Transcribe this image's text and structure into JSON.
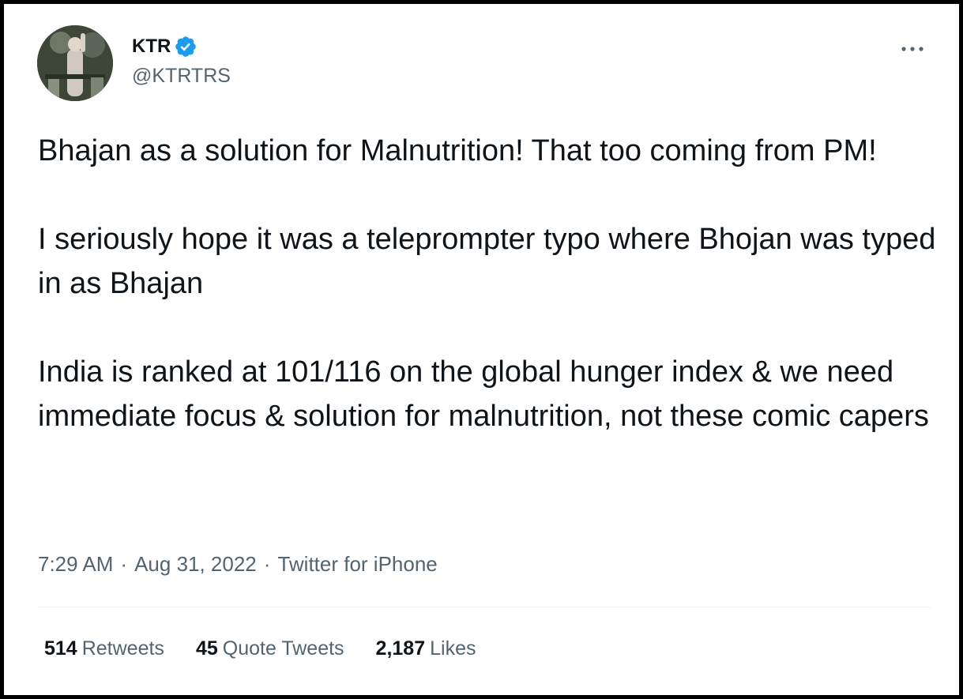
{
  "tweet": {
    "author": {
      "name": "KTR",
      "handle": "@KTRTRS",
      "verified": true,
      "verified_color": "#1d9bf0"
    },
    "paragraphs": [
      "Bhajan as a solution for Malnutrition! That too coming from PM!",
      "I seriously hope it was a teleprompter typo where Bhojan was typed in as Bhajan",
      "India is ranked at 101/116 on the global hunger index & we need immediate focus & solution for malnutrition, not these comic capers"
    ],
    "time": "7:29 AM",
    "date": "Aug 31, 2022",
    "source": "Twitter for iPhone",
    "separator": "·",
    "more_icon": "more-dots-icon",
    "stats": {
      "retweets_count": "514",
      "retweets_label": "Retweets",
      "quotes_count": "45",
      "quotes_label": "Quote Tweets",
      "likes_count": "2,187",
      "likes_label": "Likes"
    }
  }
}
